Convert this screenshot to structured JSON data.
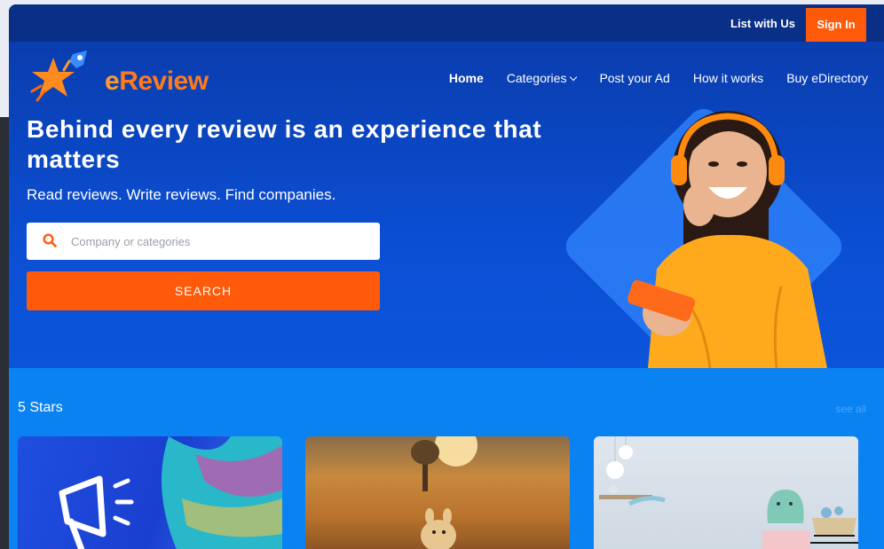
{
  "header": {
    "list_with_us": "List with Us",
    "sign_in": "Sign In"
  },
  "brand": {
    "name_e": "e",
    "name_rest": "Review"
  },
  "nav": {
    "items": [
      {
        "label": "Home",
        "active": true
      },
      {
        "label": "Categories",
        "has_dropdown": true
      },
      {
        "label": "Post your Ad"
      },
      {
        "label": "How it works"
      },
      {
        "label": "Buy eDirectory"
      }
    ]
  },
  "hero": {
    "title": "Behind every review is an experience that matters",
    "subtitle": "Read reviews. Write reviews. Find companies.",
    "search_placeholder": "Company or categories",
    "search_button": "SEARCH"
  },
  "section": {
    "title": "5 Stars",
    "see_all": "see all"
  },
  "colors": {
    "accent": "#ff5a0a",
    "hero_blue": "#0b4fd4",
    "section_blue": "#0a82f2"
  }
}
